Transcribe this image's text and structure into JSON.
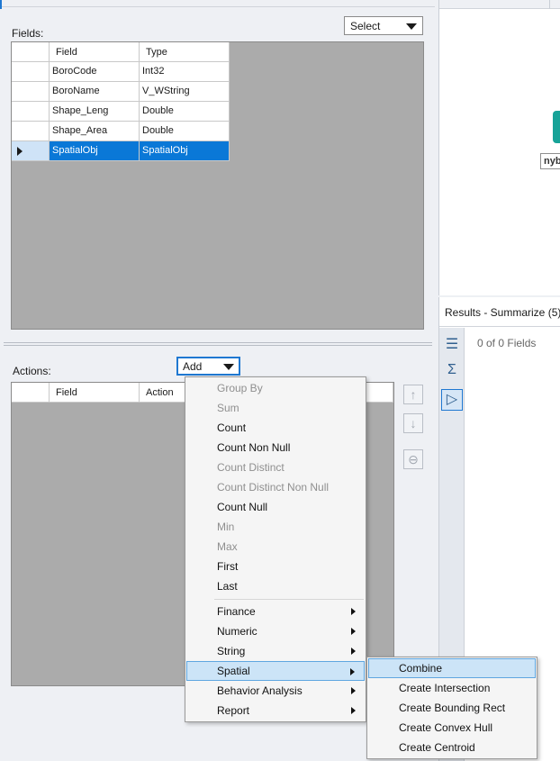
{
  "fields_panel": {
    "label": "Fields:",
    "select_combo": "Select",
    "columns": [
      "Field",
      "Type"
    ],
    "rows": [
      {
        "field": "BoroCode",
        "type": "Int32"
      },
      {
        "field": "BoroName",
        "type": "V_WString"
      },
      {
        "field": "Shape_Leng",
        "type": "Double"
      },
      {
        "field": "Shape_Area",
        "type": "Double"
      },
      {
        "field": "SpatialObj",
        "type": "SpatialObj",
        "selected": true
      }
    ]
  },
  "actions_panel": {
    "label": "Actions:",
    "add_combo": "Add",
    "columns": [
      "Field",
      "Action"
    ]
  },
  "add_menu": {
    "items": [
      {
        "label": "Group By",
        "disabled": true
      },
      {
        "label": "Sum",
        "disabled": true
      },
      {
        "label": "Count",
        "disabled": false
      },
      {
        "label": "Count Non Null",
        "disabled": false
      },
      {
        "label": "Count Distinct",
        "disabled": true
      },
      {
        "label": "Count Distinct Non Null",
        "disabled": true
      },
      {
        "label": "Count Null",
        "disabled": false
      },
      {
        "label": "Min",
        "disabled": true
      },
      {
        "label": "Max",
        "disabled": true
      },
      {
        "label": "First",
        "disabled": false
      },
      {
        "label": "Last",
        "disabled": false
      }
    ],
    "submenus": [
      {
        "label": "Finance"
      },
      {
        "label": "Numeric"
      },
      {
        "label": "String"
      },
      {
        "label": "Spatial",
        "highlighted": true
      },
      {
        "label": "Behavior Analysis"
      },
      {
        "label": "Report"
      }
    ]
  },
  "spatial_menu": {
    "items": [
      {
        "label": "Combine",
        "highlighted": true
      },
      {
        "label": "Create Intersection"
      },
      {
        "label": "Create Bounding Rect"
      },
      {
        "label": "Create Convex Hull"
      },
      {
        "label": "Create Centroid"
      }
    ]
  },
  "canvas": {
    "node_label": "nyb"
  },
  "results": {
    "title": "Results - Summarize (5)",
    "fields_count": "0 of 0 Fields"
  },
  "colors": {
    "selection": "#0a78d7",
    "menu_highlight": "#cce4f7",
    "node_teal": "#17a398",
    "grid_background": "#ababab"
  },
  "icons": {
    "move_up": "arrow-up-icon",
    "move_down": "arrow-down-icon",
    "remove": "minus-circle-icon",
    "rail": [
      "table-view-icon",
      "sigma-icon",
      "tag-icon"
    ]
  }
}
